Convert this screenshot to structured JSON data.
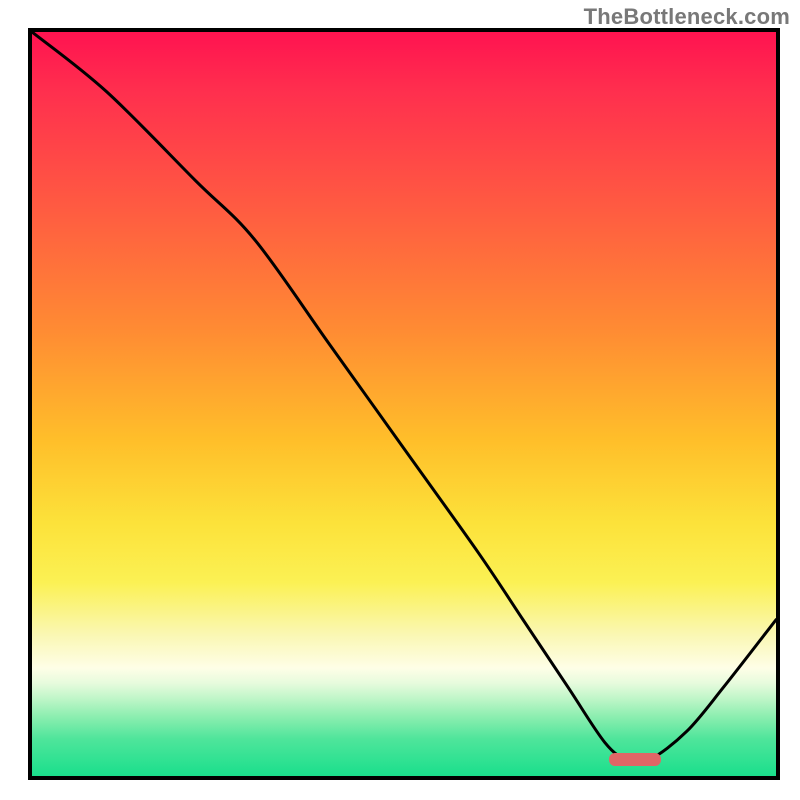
{
  "watermark": "TheBottleneck.com",
  "chart_data": {
    "type": "line",
    "title": "",
    "xlabel": "",
    "ylabel": "",
    "xlim": [
      0,
      100
    ],
    "ylim": [
      0,
      100
    ],
    "grid": false,
    "series": [
      {
        "name": "curve",
        "x": [
          0,
          10,
          22,
          30,
          40,
          50,
          60,
          66,
          72,
          77,
          80,
          83,
          88,
          93,
          100
        ],
        "y": [
          100,
          92,
          80,
          72,
          58,
          44,
          30,
          21,
          12,
          4.5,
          2.2,
          2.2,
          6,
          12,
          21
        ]
      }
    ],
    "marker": {
      "x_start": 77.5,
      "x_end": 84.5,
      "y": 2.2
    },
    "gradient_stops": [
      {
        "pos": 0,
        "color": "#ff1350"
      },
      {
        "pos": 8,
        "color": "#ff2f4e"
      },
      {
        "pos": 24,
        "color": "#ff5c41"
      },
      {
        "pos": 40,
        "color": "#ff8b33"
      },
      {
        "pos": 55,
        "color": "#ffbf2a"
      },
      {
        "pos": 66,
        "color": "#fce23a"
      },
      {
        "pos": 74,
        "color": "#fbf154"
      },
      {
        "pos": 81,
        "color": "#faf7b3"
      },
      {
        "pos": 85.5,
        "color": "#fefee7"
      },
      {
        "pos": 87.5,
        "color": "#e7fbdd"
      },
      {
        "pos": 89.5,
        "color": "#c1f6c9"
      },
      {
        "pos": 92,
        "color": "#8ceeb0"
      },
      {
        "pos": 95,
        "color": "#4fe59b"
      },
      {
        "pos": 100,
        "color": "#1adf8c"
      }
    ]
  }
}
